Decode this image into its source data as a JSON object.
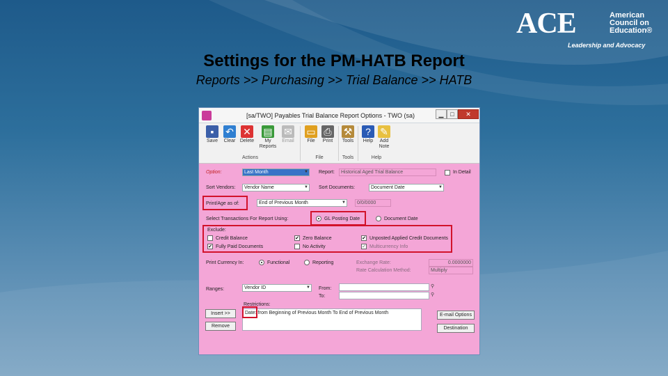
{
  "logo": {
    "mark": "ACE",
    "name_lines": [
      "American",
      "Council on",
      "Education®"
    ],
    "tagline": "Leadership and Advocacy"
  },
  "slide": {
    "title": "Settings for the PM-HATB Report",
    "subtitle": "Reports >> Purchasing >> Trial Balance >> HATB"
  },
  "window": {
    "title": "[sa/TWO] Payables Trial Balance Report Options  -  TWO (sa)",
    "controls": {
      "minimize": "▁",
      "maximize": "□",
      "close": "✕"
    }
  },
  "ribbon": {
    "buttons": [
      {
        "label": "Save",
        "icon": "save-icon",
        "color": "#3b5fa8",
        "glyph": "▪"
      },
      {
        "label": "Clear",
        "icon": "clear-icon",
        "color": "#2f7fd1",
        "glyph": "↶"
      },
      {
        "label": "Delete",
        "icon": "delete-icon",
        "color": "#d33",
        "glyph": "✕"
      },
      {
        "label": "My Reports",
        "icon": "my-reports-icon",
        "color": "#3a9a3a",
        "glyph": "▤"
      },
      {
        "label": "Email",
        "icon": "email-icon",
        "color": "#bbb",
        "glyph": "✉"
      },
      {
        "label": "File",
        "icon": "file-icon",
        "color": "#e0a020",
        "glyph": "▭"
      },
      {
        "label": "Print",
        "icon": "print-icon",
        "color": "#666",
        "glyph": "⎙"
      },
      {
        "label": "Tools",
        "icon": "tools-icon",
        "color": "#b58a3a",
        "glyph": "⚒"
      },
      {
        "label": "Help",
        "icon": "help-icon",
        "color": "#2a5bb5",
        "glyph": "?"
      },
      {
        "label": "Add Note",
        "icon": "add-note-icon",
        "color": "#e8c040",
        "glyph": "✎"
      }
    ],
    "groups": {
      "actions": "Actions",
      "file": "File",
      "tools": "Tools",
      "help": "Help"
    }
  },
  "form": {
    "option_label": "Option:",
    "option_value": "Last Month",
    "report_label": "Report:",
    "report_value": "Historical Aged Trial Balance",
    "in_detail_label": "In Detail",
    "sort_vendors_label": "Sort Vendors:",
    "sort_vendors_value": "Vendor Name",
    "sort_documents_label": "Sort Documents:",
    "sort_documents_value": "Document Date",
    "print_age_label": "Print/Age as of:",
    "print_age_value": "End of Previous Month",
    "print_age_date": "0/0/0000",
    "select_trans_label": "Select Transactions For Report Using:",
    "gl_posting_date": "GL Posting Date",
    "document_date": "Document Date",
    "exclude_label": "Exclude:",
    "exclude": {
      "credit_balance": "Credit Balance",
      "zero_balance": "Zero Balance",
      "unposted_applied": "Unposted Applied Credit Documents",
      "fully_paid": "Fully Paid Documents",
      "no_activity": "No Activity",
      "multicurrency": "Multicurrency Info"
    },
    "print_currency_label": "Print Currency In:",
    "functional": "Functional",
    "reporting": "Reporting",
    "exchange_rate_label": "Exchange Rate:",
    "exchange_rate_value": "0.0000000",
    "rate_calc_label": "Rate Calculation Method:",
    "rate_calc_value": "Multiply",
    "ranges_label": "Ranges:",
    "ranges_value": "Vendor ID",
    "from_label": "From:",
    "to_label": "To:",
    "restrictions_label": "Restrictions:",
    "restriction_text": "Date: from Beginning of Previous Month To End of Previous Month",
    "insert_button": "Insert >>",
    "remove_button": "Remove",
    "email_options_button": "E-mail Options",
    "destination_button": "Destination",
    "check_mark": "✔"
  }
}
